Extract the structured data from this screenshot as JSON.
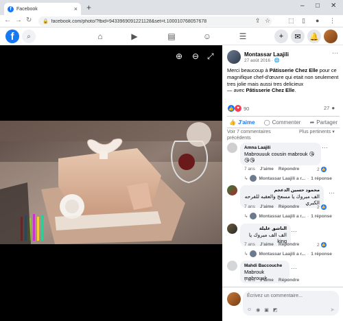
{
  "browser": {
    "tab_title": "Facebook",
    "url": "facebook.com/photo/?fbid=9433969091221128&set=t.100010768057678",
    "win_min": "–",
    "win_max": "□",
    "win_close": "✕"
  },
  "photo": {
    "viewer": [
      "zoom-in",
      "zoom-out",
      "fullscreen"
    ]
  },
  "post": {
    "author": "Montassar Laajili",
    "date": "27 août 2016",
    "date_icon": "🌐",
    "text_prefix": "Merci beaucoup à ",
    "text_link1": "Pâtisserie Chez Elle",
    "text_mid": " pour ce magnifique chef-d'œuvre qui etait non seulement tres jolie mais aussi tres delicieux",
    "with_prefix": "— avec ",
    "with_link": "Pâtisserie Chez Elle",
    "with_suffix": ".",
    "reactions_count": "90",
    "comments_count": "27"
  },
  "actions": {
    "like": "J'aime",
    "comment": "Commenter",
    "share": "Partager"
  },
  "comments_header": {
    "previous": "Voir 7 commentaires précédents",
    "sort": "Plus pertinents"
  },
  "comments": [
    {
      "name": "Amna Laajili",
      "text": "Mabrouuuk cousin mabrouk 😘😘😘",
      "time": "7 ans",
      "like": "J'aime",
      "reply": "Répondre",
      "likes": "2",
      "reply_author": "Montassar Laajili a r...",
      "reply_count": "1 réponse"
    },
    {
      "name": "محمود حسين الدعجم",
      "text": "الف مبروك يا مسعج والعقبه للفرحه الكبري",
      "time": "7 ans",
      "like": "J'aime",
      "reply": "Répondre",
      "likes": "2",
      "reply_author": "Montassar Laajili a r...",
      "reply_count": "1 réponse"
    },
    {
      "name": "الناشق عليلة",
      "text": "الف الف مبروك يا king",
      "time": "7 ans",
      "like": "J'aime",
      "reply": "Répondre",
      "likes": "2",
      "reply_author": "Montassar Laajili a r...",
      "reply_count": "1 réponse"
    },
    {
      "name": "Mahdi Baccouche",
      "text": "Mabrouk mabrouuk",
      "time": "7 ans",
      "like": "J'aime",
      "reply": "Répondre",
      "likes": "",
      "reply_author": "",
      "reply_count": ""
    }
  ],
  "composer": {
    "placeholder": "Écrivez un commentaire..."
  },
  "colors": {
    "brand": "#1877f2",
    "love": "#f33e58",
    "bubble": "#f0f2f5"
  }
}
